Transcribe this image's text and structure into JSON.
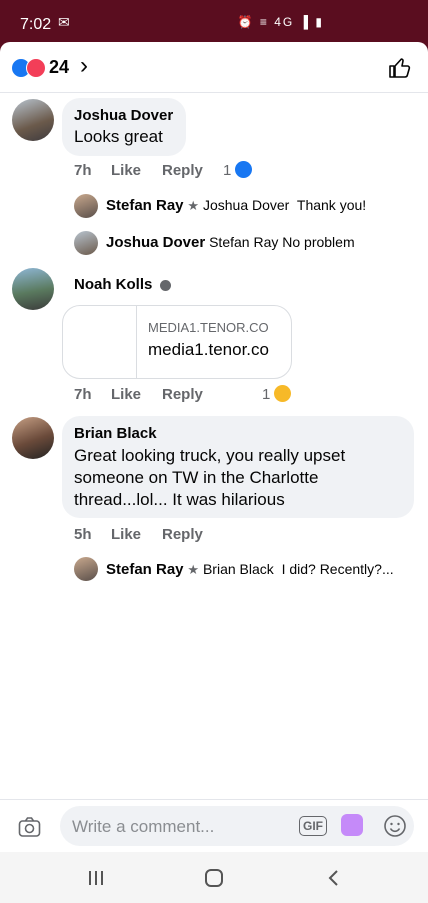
{
  "status_bar": {
    "time": "7:02",
    "mail_glyph": "✉",
    "system_glyph": "⏰ ≡ 4G ▐ ▮"
  },
  "header": {
    "reaction_count": "24",
    "chevron": "›"
  },
  "comments": [
    {
      "author": "Joshua Dover",
      "text": "Looks great",
      "time": "7h",
      "like": "Like",
      "reply": "Reply",
      "reaction_count": "1",
      "replies": [
        {
          "author": "Stefan Ray",
          "mention": "Joshua Dover",
          "text": "Thank you!"
        },
        {
          "author": "Joshua Dover",
          "mention": "Stefan Ray",
          "text": "No problem"
        }
      ]
    },
    {
      "author": "Noah Kolls",
      "link_domain": "MEDIA1.TENOR.CO",
      "link_title": "media1.tenor.co",
      "time": "7h",
      "like": "Like",
      "reply": "Reply",
      "reaction_count": "1"
    },
    {
      "author": "Brian Black",
      "text_lines": [
        "Great looking truck, you really upset",
        "someone on TW in the Charlotte",
        "thread...lol... It was hilarious"
      ],
      "time": "5h",
      "like": "Like",
      "reply": "Reply",
      "replies": [
        {
          "author": "Stefan Ray",
          "mention": "Brian Black",
          "text": "I did? Recently?..."
        }
      ]
    }
  ],
  "composer": {
    "placeholder": "Write a comment...",
    "gif_label": "GIF"
  },
  "colors": {
    "status_bar": "#5a0d1f",
    "like_blue": "#1877f2",
    "love_red": "#f33e58",
    "meta_gray": "#65676b",
    "bubble": "#f0f2f5"
  }
}
